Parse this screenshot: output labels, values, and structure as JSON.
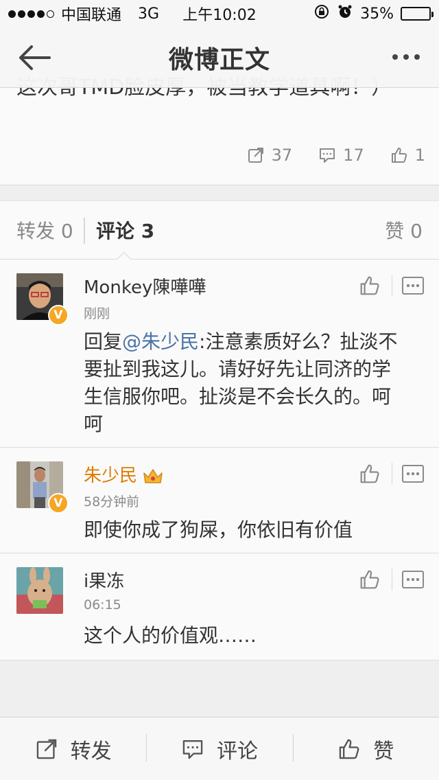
{
  "status_bar": {
    "carrier": "中国联通",
    "network": "3G",
    "time": "上午10:02",
    "battery": "35%",
    "battery_level": 0.35
  },
  "nav": {
    "title": "微博正文"
  },
  "post": {
    "text": "这次哥TMD脸皮厚，被当教学道具啊！）",
    "repost_count": "37",
    "comment_count": "17",
    "like_count": "1"
  },
  "tabs": {
    "repost": "转发 0",
    "comment": "评论 3",
    "like": "赞 0"
  },
  "comments": [
    {
      "name": "Monkey陳嘩嘩",
      "time": "刚刚",
      "text_prefix": "回复",
      "mention": "@朱少民",
      "text": ":注意素质好么？扯淡不要扯到我这儿。请好好先让同济的学生信服你吧。扯淡是不会长久的。呵呵",
      "verified_badge": "V"
    },
    {
      "name": "朱少民",
      "time": "58分钟前",
      "text": "即使你成了狗屎，你依旧有价值",
      "verified_badge": "V"
    },
    {
      "name": "i果冻",
      "time": "06:15",
      "text": "这个人的价值观……"
    }
  ],
  "toolbar": {
    "repost": "转发",
    "comment": "评论",
    "like": "赞"
  },
  "colors": {
    "mention": "#4a73a8",
    "vip_name": "#e07b00",
    "badge": "#f5a623"
  }
}
